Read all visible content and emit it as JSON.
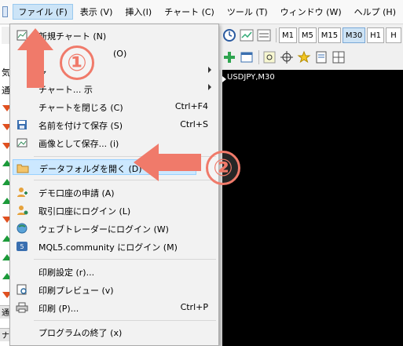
{
  "menubar": {
    "items": [
      "ファイル (F)",
      "表示 (V)",
      "挿入(I)",
      "チャート (C)",
      "ツール (T)",
      "ウィンドウ (W)",
      "ヘルプ (H)"
    ]
  },
  "toolbar": {
    "timeframes": [
      "M1",
      "M5",
      "M15",
      "M30",
      "H1",
      "H"
    ],
    "selected_timeframe": "M30"
  },
  "left_panel": {
    "header_label": "気",
    "sub_label": "通",
    "tab_label": "通",
    "nav_label": "ナビ"
  },
  "chart": {
    "symbol_label": "USDJPY,M30"
  },
  "file_menu": {
    "items": [
      {
        "label": "新規チャート (N)",
        "shortcut": ""
      },
      {
        "label": "(O)",
        "shortcut": ""
      },
      {
        "label": "ャ",
        "shortcut": ""
      },
      {
        "label": "チャート... 示",
        "shortcut": ""
      },
      {
        "label": "チャートを閉じる (C)",
        "shortcut": "Ctrl+F4"
      },
      {
        "label": "名前を付けて保存 (S)",
        "shortcut": "Ctrl+S"
      },
      {
        "label": "画像として保存... (i)",
        "shortcut": ""
      },
      {
        "label": "データフォルダを開く (D)",
        "shortcut": ""
      },
      {
        "label": "デモ口座の申請 (A)",
        "shortcut": ""
      },
      {
        "label": "取引口座にログイン (L)",
        "shortcut": ""
      },
      {
        "label": "ウェブトレーダーにログイン (W)",
        "shortcut": ""
      },
      {
        "label": "MQL5.community にログイン (M)",
        "shortcut": ""
      },
      {
        "label": "印刷設定 (r)...",
        "shortcut": ""
      },
      {
        "label": "印刷プレビュー (v)",
        "shortcut": ""
      },
      {
        "label": "印刷 (P)...",
        "shortcut": "Ctrl+P"
      },
      {
        "label": "プログラムの終了 (x)",
        "shortcut": ""
      }
    ]
  },
  "annotations": {
    "step1": "①",
    "step2": "②",
    "arrow_color": "#f07a6a"
  }
}
